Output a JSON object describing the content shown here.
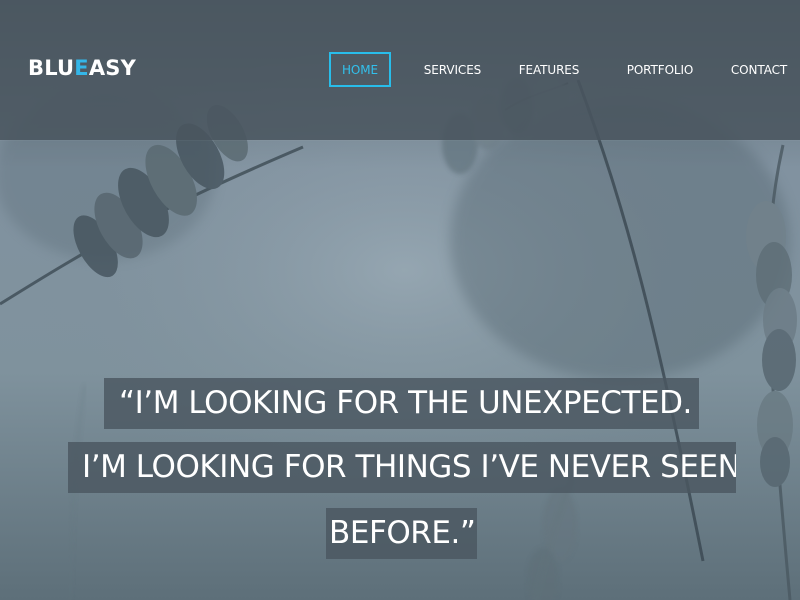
{
  "site": {
    "brand": {
      "prefix": "BLU",
      "accent": "E",
      "suffix": "ASY"
    },
    "colors": {
      "header_bg": "#49555e",
      "accent": "#34b6e8",
      "text": "#ffffff",
      "quote_bg": "#4b5760"
    }
  },
  "nav": {
    "items": [
      {
        "label": "HOME",
        "state": "active"
      },
      {
        "label": "SERVICES"
      },
      {
        "label": "FEATURES"
      },
      {
        "label": "PORTFOLIO"
      },
      {
        "label": "CONTACT"
      }
    ]
  },
  "hero": {
    "quote_lines": [
      "“I’M LOOKING FOR THE UNEXPECTED.",
      "I’M LOOKING FOR THINGS I’VE NEVER SEEN",
      "BEFORE.”"
    ]
  }
}
